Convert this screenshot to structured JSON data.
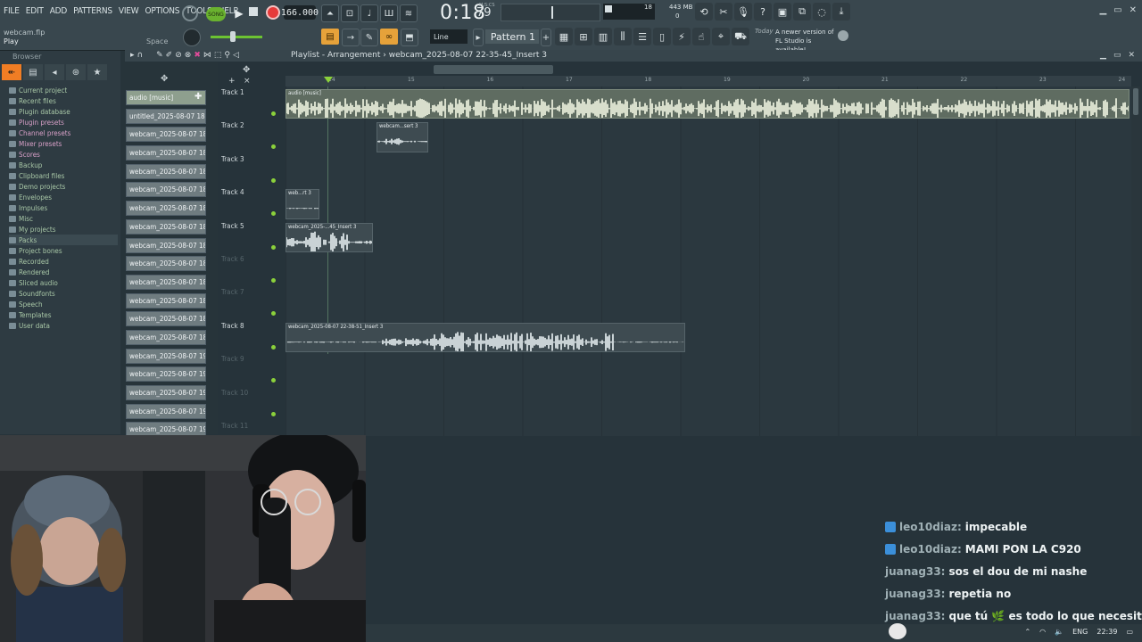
{
  "menu": [
    "FILE",
    "EDIT",
    "ADD",
    "PATTERNS",
    "VIEW",
    "OPTIONS",
    "TOOLS",
    "HELP"
  ],
  "project": {
    "file": "webcam.flp",
    "hint": "Play",
    "space_hint": "Space"
  },
  "transport": {
    "song_label": "SONG",
    "tempo": "166.000",
    "time_main": "0:18",
    "time_ms": "79",
    "time_unit": "M:S:CS"
  },
  "monitor": {
    "cpu": "18",
    "memory": "443 MB",
    "memory_low": "0"
  },
  "toolbar2": {
    "snap": "Line",
    "pattern": "Pattern 1"
  },
  "news": {
    "day": "Today",
    "text": "A newer version of FL Studio is available!"
  },
  "browser": {
    "title": "Browser",
    "items": [
      {
        "label": "Current project",
        "style": "green"
      },
      {
        "label": "Recent files",
        "style": "green"
      },
      {
        "label": "Plugin database",
        "style": "green"
      },
      {
        "label": "Plugin presets",
        "style": "pink"
      },
      {
        "label": "Channel presets",
        "style": "pink"
      },
      {
        "label": "Mixer presets",
        "style": "pink"
      },
      {
        "label": "Scores",
        "style": "pink"
      },
      {
        "label": "Backup",
        "style": "green"
      },
      {
        "label": "Clipboard files",
        "style": "green"
      },
      {
        "label": "Demo projects",
        "style": "green"
      },
      {
        "label": "Envelopes",
        "style": "green"
      },
      {
        "label": "Impulses",
        "style": "green"
      },
      {
        "label": "Misc",
        "style": "green"
      },
      {
        "label": "My projects",
        "style": "green"
      },
      {
        "label": "Packs",
        "style": "green"
      },
      {
        "label": "Project bones",
        "style": "green"
      },
      {
        "label": "Recorded",
        "style": "green"
      },
      {
        "label": "Rendered",
        "style": "green"
      },
      {
        "label": "Sliced audio",
        "style": "green"
      },
      {
        "label": "Soundfonts",
        "style": "green"
      },
      {
        "label": "Speech",
        "style": "green"
      },
      {
        "label": "Templates",
        "style": "green"
      },
      {
        "label": "User data",
        "style": "green"
      }
    ]
  },
  "clips": [
    "audio [music]",
    "untitled_2025-08-07 18-...",
    "webcam_2025-08-07 18...",
    "webcam_2025-08-07 18...",
    "webcam_2025-08-07 18...",
    "webcam_2025-08-07 18...",
    "webcam_2025-08-07 18...",
    "webcam_2025-08-07 18...",
    "webcam_2025-08-07 18...",
    "webcam_2025-08-07 18...",
    "webcam_2025-08-07 18...",
    "webcam_2025-08-07 18...",
    "webcam_2025-08-07 18...",
    "webcam_2025-08-07 18...",
    "webcam_2025-08-07 19...",
    "webcam_2025-08-07 19...",
    "webcam_2025-08-07 19...",
    "webcam_2025-08-07 19...",
    "webcam_2025-08-07 19..."
  ],
  "playlist": {
    "title": "Playlist - Arrangement",
    "breadcrumb": "webcam_2025-08-07 22-35-45_Insert 3",
    "ruler": [
      "14",
      "15",
      "16",
      "17",
      "18",
      "19",
      "20",
      "21",
      "22",
      "23",
      "24"
    ],
    "tracks": [
      {
        "name": "Track 1",
        "active": true
      },
      {
        "name": "Track 2",
        "active": true
      },
      {
        "name": "Track 3",
        "active": true
      },
      {
        "name": "Track 4",
        "active": true
      },
      {
        "name": "Track 5",
        "active": true
      },
      {
        "name": "Track 6",
        "active": false
      },
      {
        "name": "Track 7",
        "active": false
      },
      {
        "name": "Track 8",
        "active": true
      },
      {
        "name": "Track 9",
        "active": false
      },
      {
        "name": "Track 10",
        "active": false
      },
      {
        "name": "Track 11",
        "active": false
      }
    ],
    "audio_clips": {
      "music": "audio [music]",
      "t2": "webcam...sert 3",
      "t4": "web...rt 3",
      "t5": "webcam_2025-...45_Insert 3",
      "t8": "webcam_2025-08-07 22-38-51_Insert 3"
    }
  },
  "chat": [
    {
      "user": "leo10diaz:",
      "msg": "impecable",
      "badge": true
    },
    {
      "user": "leo10diaz:",
      "msg": "MAMI PON LA C920",
      "badge": true
    },
    {
      "user": "juanag33:",
      "msg": "sos el dou de mi nashe",
      "badge": false
    },
    {
      "user": "juanag33:",
      "msg": "repetia no",
      "badge": false
    },
    {
      "user": "juanag33:",
      "msg": "que tú 🌿 es todo lo que necesito",
      "badge": false
    }
  ],
  "tray": {
    "lang": "ENG",
    "clock": "22:39"
  },
  "colors": {
    "accent_orange": "#f07d24",
    "song_green": "#6ab22f",
    "record_red": "#e63a3a",
    "led_green": "#8bd13b"
  }
}
